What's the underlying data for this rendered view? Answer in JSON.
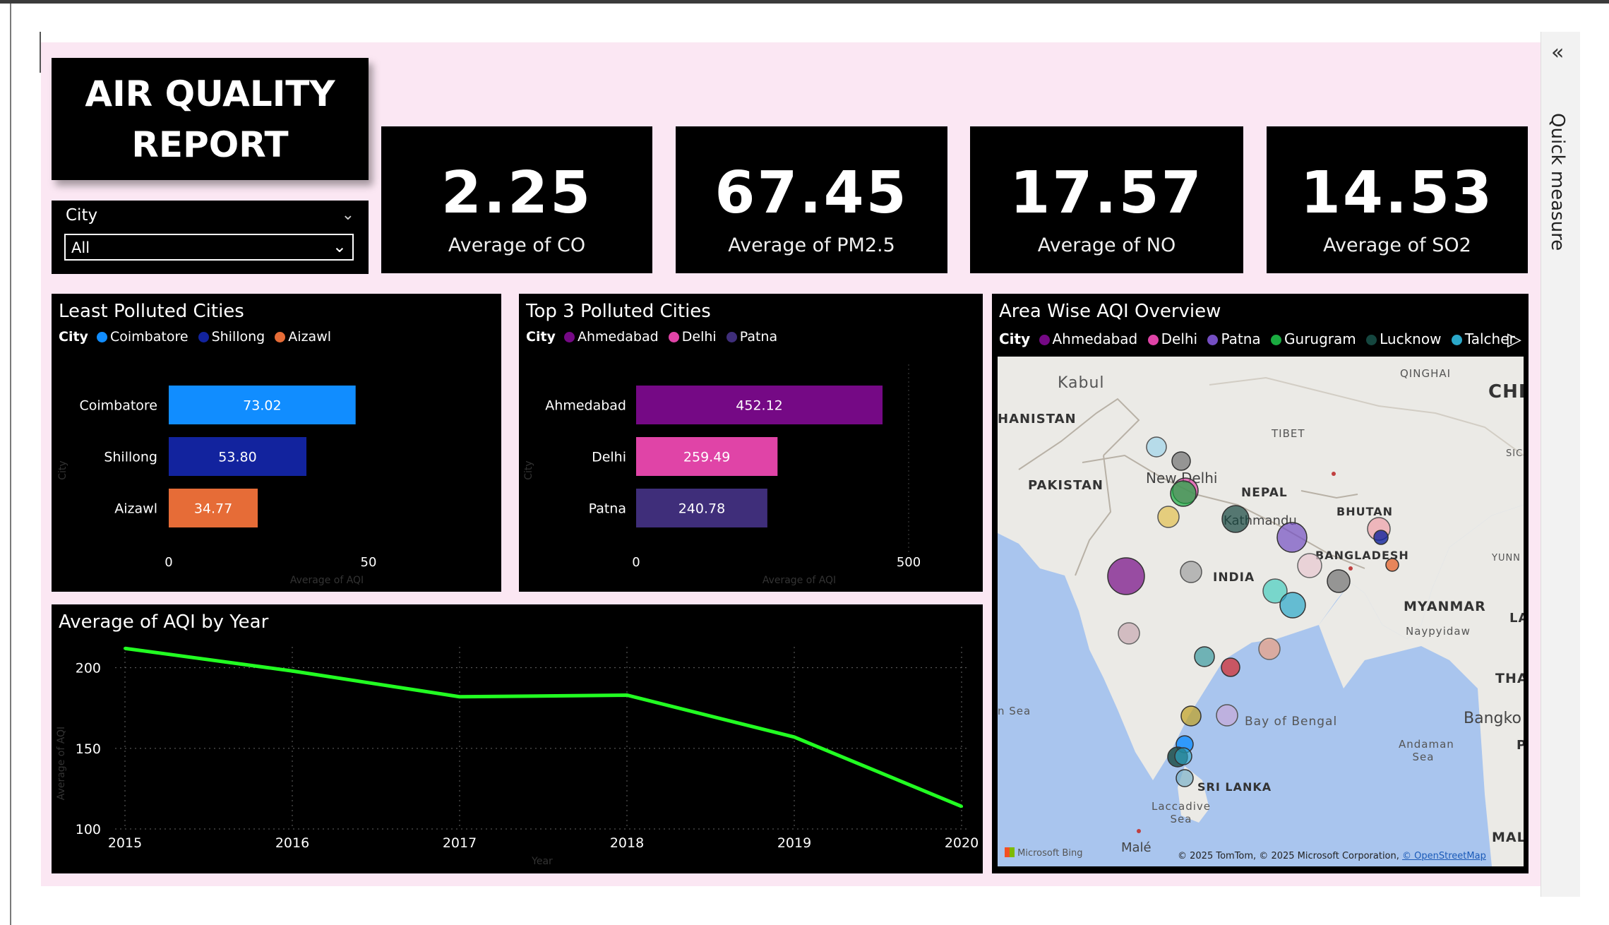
{
  "report": {
    "title_line1": "AIR QUALITY",
    "title_line2": "REPORT"
  },
  "slicer": {
    "label": "City",
    "value": "All"
  },
  "kpis": [
    {
      "value": "2.25",
      "label": "Average of CO"
    },
    {
      "value": "67.45",
      "label": "Average of PM2.5"
    },
    {
      "value": "17.57",
      "label": "Average of NO"
    },
    {
      "value": "14.53",
      "label": "Average of SO2"
    }
  ],
  "least_polluted": {
    "title": "Least Polluted Cities",
    "legend_title": "City",
    "legend": [
      {
        "name": "Coimbatore",
        "color": "#118DFF"
      },
      {
        "name": "Shillong",
        "color": "#12239E"
      },
      {
        "name": "Aizawl",
        "color": "#E66C37"
      }
    ],
    "ylabel": "City",
    "xlabel": "Average of AQI",
    "ticks": [
      "0",
      "50"
    ]
  },
  "top3": {
    "title": "Top 3 Polluted Cities",
    "legend_title": "City",
    "legend": [
      {
        "name": "Ahmedabad",
        "color": "#750985"
      },
      {
        "name": "Delhi",
        "color": "#E044A7"
      },
      {
        "name": "Patna",
        "color": "#3F2E7A"
      }
    ],
    "ylabel": "City",
    "xlabel": "Average of AQI",
    "ticks": [
      "0",
      "500"
    ]
  },
  "line": {
    "title": "Average of AQI by Year",
    "xlabel": "Year",
    "ylabel": "Average of AQI",
    "color": "#22FF22"
  },
  "map": {
    "title": "Area Wise AQI Overview",
    "legend_title": "City",
    "legend": [
      {
        "name": "Ahmedabad",
        "color": "#750985"
      },
      {
        "name": "Delhi",
        "color": "#E044A7"
      },
      {
        "name": "Patna",
        "color": "#744EC2"
      },
      {
        "name": "Gurugram",
        "color": "#1AAB40"
      },
      {
        "name": "Lucknow",
        "color": "#15463F"
      },
      {
        "name": "Talcher",
        "color": "#2BA8C9"
      }
    ],
    "labels": {
      "kabul": "Kabul",
      "afghanistan": "HANISTAN",
      "pakistan": "PAKISTAN",
      "tibet": "TIBET",
      "qinghai": "QINGHAI",
      "china": "CHI",
      "newdelhi": "New Delhi",
      "nepal": "NEPAL",
      "kathmandu": "Kathmandu",
      "bhutan": "BHUTAN",
      "bangladesh": "BANGLADESH",
      "india": "INDIA",
      "myanmar": "MYANMAR",
      "naypyidaw": "Naypyidaw",
      "thai": "THAIL",
      "bangko": "Bangko",
      "arabian": "n Sea",
      "bay": "Bay of Bengal",
      "andaman": "Andaman Sea",
      "srilanka": "SRI LANKA",
      "laccadive": "Laccadive Sea",
      "male": "Malé",
      "mal": "MAL",
      "si": "SIC",
      "yunn": "YUNN",
      "la": "LA",
      "p": "P"
    },
    "attribution": "© 2025 TomTom, © 2025 Microsoft Corporation,",
    "osm": "© OpenStreetMap",
    "bing": "Microsoft Bing"
  },
  "sidebar": {
    "label": "Quick measure"
  },
  "chart_data": [
    {
      "type": "bar",
      "title": "Least Polluted Cities",
      "categories": [
        "Coimbatore",
        "Shillong",
        "Aizawl"
      ],
      "values": [
        73.02,
        53.8,
        34.77
      ],
      "value_labels": [
        "73.02",
        "53.80",
        "34.77"
      ],
      "colors": [
        "#118DFF",
        "#12239E",
        "#E66C37"
      ],
      "xlabel": "Average of AQI",
      "ylabel": "City",
      "xlim": [
        0,
        80
      ]
    },
    {
      "type": "bar",
      "title": "Top 3 Polluted Cities",
      "categories": [
        "Ahmedabad",
        "Delhi",
        "Patna"
      ],
      "values": [
        452.12,
        259.49,
        240.78
      ],
      "value_labels": [
        "452.12",
        "259.49",
        "240.78"
      ],
      "colors": [
        "#750985",
        "#E044A7",
        "#3F2E7A"
      ],
      "xlabel": "Average of AQI",
      "ylabel": "City",
      "xlim": [
        0,
        500
      ]
    },
    {
      "type": "line",
      "title": "Average of AQI by Year",
      "x": [
        "2015",
        "2016",
        "2017",
        "2018",
        "2019",
        "2020"
      ],
      "values": [
        212,
        198,
        182,
        183,
        157,
        114
      ],
      "xlabel": "Year",
      "ylabel": "Average of AQI",
      "yticks": [
        "100",
        "150",
        "200"
      ],
      "ylim": [
        100,
        220
      ],
      "grid": true
    }
  ]
}
